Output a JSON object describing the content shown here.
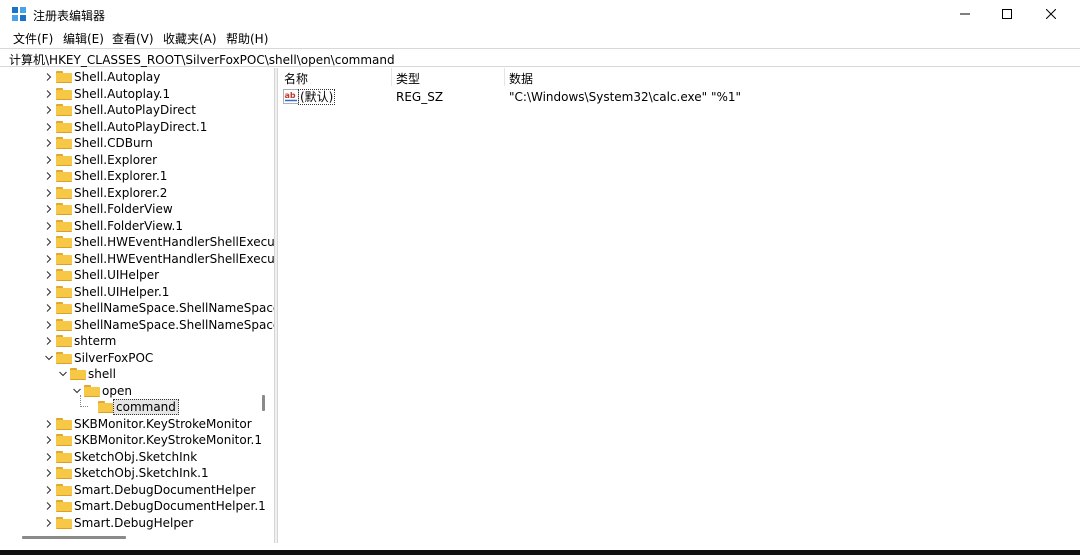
{
  "window": {
    "title": "注册表编辑器"
  },
  "menu": {
    "items": [
      "文件(F)",
      "编辑(E)",
      "查看(V)",
      "收藏夹(A)",
      "帮助(H)"
    ]
  },
  "address": {
    "path": "计算机\\HKEY_CLASSES_ROOT\\SilverFoxPOC\\shell\\open\\command"
  },
  "tree": {
    "items": [
      {
        "label": "Shell.Autoplay",
        "expanded": false,
        "level": 0
      },
      {
        "label": "Shell.Autoplay.1",
        "expanded": false,
        "level": 0
      },
      {
        "label": "Shell.AutoPlayDirect",
        "expanded": false,
        "level": 0
      },
      {
        "label": "Shell.AutoPlayDirect.1",
        "expanded": false,
        "level": 0
      },
      {
        "label": "Shell.CDBurn",
        "expanded": false,
        "level": 0
      },
      {
        "label": "Shell.Explorer",
        "expanded": false,
        "level": 0
      },
      {
        "label": "Shell.Explorer.1",
        "expanded": false,
        "level": 0
      },
      {
        "label": "Shell.Explorer.2",
        "expanded": false,
        "level": 0
      },
      {
        "label": "Shell.FolderView",
        "expanded": false,
        "level": 0
      },
      {
        "label": "Shell.FolderView.1",
        "expanded": false,
        "level": 0
      },
      {
        "label": "Shell.HWEventHandlerShellExecu",
        "expanded": false,
        "level": 0
      },
      {
        "label": "Shell.HWEventHandlerShellExecu",
        "expanded": false,
        "level": 0
      },
      {
        "label": "Shell.UIHelper",
        "expanded": false,
        "level": 0
      },
      {
        "label": "Shell.UIHelper.1",
        "expanded": false,
        "level": 0
      },
      {
        "label": "ShellNameSpace.ShellNameSpace",
        "expanded": false,
        "level": 0
      },
      {
        "label": "ShellNameSpace.ShellNameSpace",
        "expanded": false,
        "level": 0
      },
      {
        "label": "shterm",
        "expanded": false,
        "level": 0
      },
      {
        "label": "SilverFoxPOC",
        "expanded": true,
        "level": 0
      },
      {
        "label": "shell",
        "expanded": true,
        "level": 1
      },
      {
        "label": "open",
        "expanded": true,
        "level": 2
      },
      {
        "label": "command",
        "expanded": null,
        "level": 3,
        "selected": true
      },
      {
        "label": "SKBMonitor.KeyStrokeMonitor",
        "expanded": false,
        "level": 0
      },
      {
        "label": "SKBMonitor.KeyStrokeMonitor.1",
        "expanded": false,
        "level": 0
      },
      {
        "label": "SketchObj.SketchInk",
        "expanded": false,
        "level": 0
      },
      {
        "label": "SketchObj.SketchInk.1",
        "expanded": false,
        "level": 0
      },
      {
        "label": "Smart.DebugDocumentHelper",
        "expanded": false,
        "level": 0
      },
      {
        "label": "Smart.DebugDocumentHelper.1",
        "expanded": false,
        "level": 0
      },
      {
        "label": "Smart.DebugHelper",
        "expanded": false,
        "level": 0
      }
    ]
  },
  "list": {
    "headers": {
      "name": "名称",
      "type": "类型",
      "data": "数据"
    },
    "rows": [
      {
        "name": "(默认)",
        "type": "REG_SZ",
        "data": "\"C:\\Windows\\System32\\calc.exe\" \"%1\"",
        "icon": "reg-sz-icon"
      }
    ]
  },
  "colors": {
    "folder": "#f6c845",
    "selection": "#e5e5e5"
  }
}
